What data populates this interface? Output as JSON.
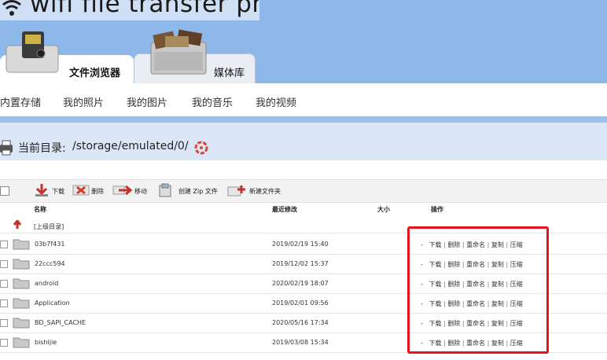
{
  "app": {
    "title": "wifi file transfer pro"
  },
  "tabs": [
    {
      "label": "文件浏览器",
      "active": true
    },
    {
      "label": "媒体库",
      "active": false
    }
  ],
  "nav": [
    "内置存储",
    "我的照片",
    "我的图片",
    "我的音乐",
    "我的视频"
  ],
  "directory": {
    "label": "当前目录:",
    "path": "/storage/emulated/0/"
  },
  "toolbar": {
    "download": "下载",
    "delete": "删除",
    "move": "移动",
    "zip": "创建 Zip 文件",
    "new_folder": "新建文件夹"
  },
  "table": {
    "headers": {
      "name": "名称",
      "modified": "最近修改",
      "size": "大小",
      "actions": "操作"
    },
    "parent_label": "[上级目录]",
    "rows": [
      {
        "name": "03b7f431",
        "modified": "2019/02/19 15:40"
      },
      {
        "name": "22ccc594",
        "modified": "2019/12/02 15:37"
      },
      {
        "name": "android",
        "modified": "2020/02/19 18:07"
      },
      {
        "name": "Application",
        "modified": "2019/02/01 09:56"
      },
      {
        "name": "BD_SAPI_CACHE",
        "modified": "2020/05/16 17:34"
      },
      {
        "name": "bishijie",
        "modified": "2019/03/08 15:34"
      }
    ],
    "row_actions": {
      "dash": "-",
      "download": "下载",
      "delete": "删除",
      "rename": "重命名",
      "copy": "复制",
      "compress": "压缩",
      "separator": "|"
    }
  },
  "colors": {
    "header_bg": "#8fb8ea",
    "dir_bar_bg": "#dbe7f6",
    "highlight": "#e8101a",
    "delete_icon": "#d33b2c",
    "arrow_icon": "#c4302b"
  }
}
